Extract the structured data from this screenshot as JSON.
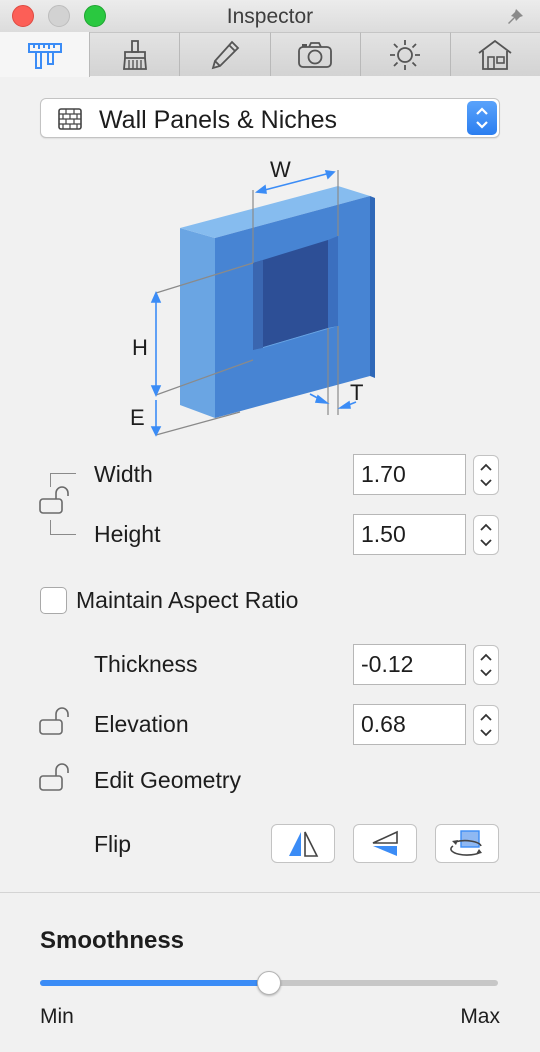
{
  "window": {
    "title": "Inspector"
  },
  "tabs": [
    {
      "name": "dimensions",
      "icon": "caliper-ruler-icon",
      "active": true
    },
    {
      "name": "materials",
      "icon": "paint-brush-icon",
      "active": false
    },
    {
      "name": "edit",
      "icon": "pencil-icon",
      "active": false
    },
    {
      "name": "camera",
      "icon": "camera-icon",
      "active": false
    },
    {
      "name": "lighting",
      "icon": "sun-icon",
      "active": false
    },
    {
      "name": "building",
      "icon": "house-icon",
      "active": false
    }
  ],
  "object_type": {
    "icon": "brick-wall-icon",
    "selected": "Wall Panels & Niches"
  },
  "diagram": {
    "w_label": "W",
    "h_label": "H",
    "e_label": "E",
    "t_label": "T"
  },
  "fields": {
    "width": {
      "label": "Width",
      "value": "1.70"
    },
    "height": {
      "label": "Height",
      "value": "1.50"
    },
    "thickness": {
      "label": "Thickness",
      "value": "-0.12"
    },
    "elevation": {
      "label": "Elevation",
      "value": "0.68"
    }
  },
  "aspect_ratio": {
    "label": "Maintain Aspect Ratio",
    "checked": false
  },
  "edit_geometry": {
    "label": "Edit Geometry"
  },
  "flip": {
    "label": "Flip",
    "buttons": [
      "flip-horizontal-icon",
      "flip-vertical-icon",
      "rotate-icon"
    ]
  },
  "smoothness": {
    "title": "Smoothness",
    "min_label": "Min",
    "max_label": "Max",
    "value": 0.5
  },
  "colors": {
    "accent": "#3b8cf6",
    "panel_front": "#4784d3",
    "panel_side": "#6aa5e3",
    "panel_top": "#86bcef",
    "niche": "#2d4f96"
  }
}
